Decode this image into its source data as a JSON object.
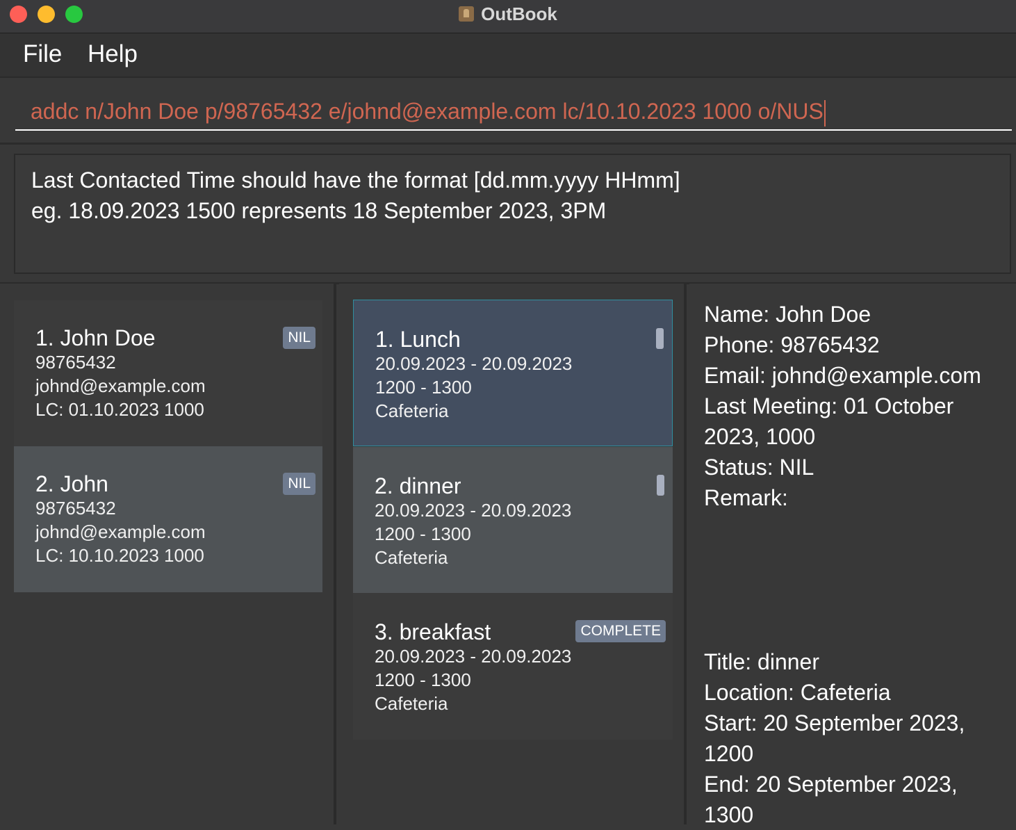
{
  "window": {
    "title": "OutBook"
  },
  "menu": {
    "file": "File",
    "help": "Help"
  },
  "command": {
    "value": "addc n/John Doe p/98765432 e/johnd@example.com lc/10.10.2023 1000 o/NUS"
  },
  "result": {
    "line1": "Last Contacted Time should have the format [dd.mm.yyyy HHmm]",
    "line2": "eg. 18.09.2023 1500 represents 18 September 2023, 3PM"
  },
  "persons": [
    {
      "title": "1.  John Doe",
      "phone": "98765432",
      "email": "johnd@example.com",
      "lc": "LC: 01.10.2023 1000",
      "tag": "NIL"
    },
    {
      "title": "2.  John",
      "phone": "98765432",
      "email": "johnd@example.com",
      "lc": "LC: 10.10.2023 1000",
      "tag": "NIL"
    }
  ],
  "meetings": [
    {
      "title": "1.  Lunch",
      "dates": "20.09.2023  -  20.09.2023",
      "times": "1200  -  1300",
      "location": "Cafeteria"
    },
    {
      "title": "2.  dinner",
      "dates": "20.09.2023  -  20.09.2023",
      "times": "1200  -  1300",
      "location": "Cafeteria"
    },
    {
      "title": "3.  breakfast",
      "dates": "20.09.2023  -  20.09.2023",
      "times": "1200  -  1300",
      "location": "Cafeteria",
      "tag": "COMPLETE"
    }
  ],
  "person_detail": {
    "name": "Name: John Doe",
    "phone": "Phone: 98765432",
    "email": "Email: johnd@example.com",
    "last_meeting": "Last Meeting: 01 October 2023, 1000",
    "status": "Status: NIL",
    "remark": "Remark:"
  },
  "meeting_detail": {
    "title": "Title: dinner",
    "location": "Location: Cafeteria",
    "start": "Start: 20 September 2023, 1200",
    "end": "End: 20 September 2023, 1300"
  }
}
